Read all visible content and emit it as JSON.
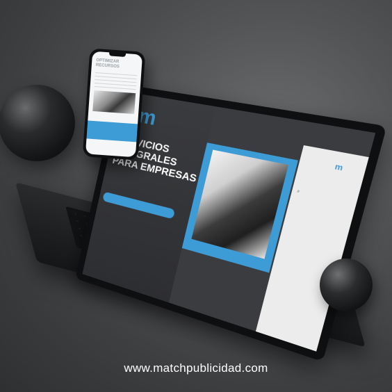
{
  "footer": {
    "url": "www.matchpublicidad.com"
  },
  "laptop": {
    "logo": "m",
    "hero_title": "SERVICIOS INTEGRALES PARA EMPRESAS",
    "side_logo": "m"
  },
  "phone": {
    "title": "OPTIMIZAR RECURSOS"
  },
  "colors": {
    "accent": "#3d9bd6",
    "background": "#4a4b4d"
  },
  "icons": {
    "search": "search-icon"
  }
}
